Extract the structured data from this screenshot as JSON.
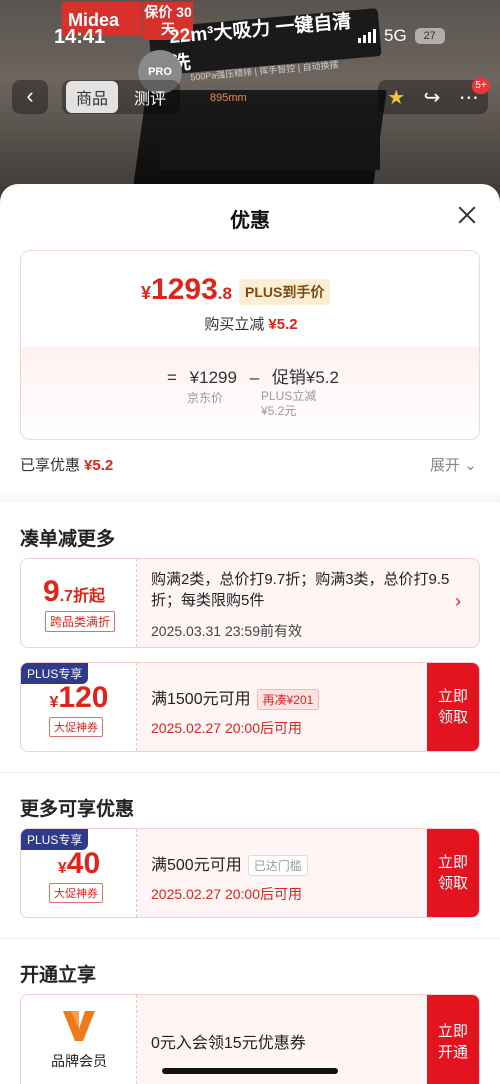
{
  "status_bar": {
    "time": "14:41",
    "network": "5G",
    "battery": "27"
  },
  "hero": {
    "brand": "Midea",
    "brand_tag": "保价 30天",
    "slogan": "22m³大吸力 一键自清洗",
    "slogan_sub": "500Pa强压精排 | 挥手智控 | 自动换摆",
    "pro_badge": "PRO",
    "dimension": "895mm"
  },
  "nav": {
    "back_icon": "chevron-left-icon",
    "tabs": [
      {
        "label": "商品",
        "active": true
      },
      {
        "label": "测评",
        "active": false
      }
    ],
    "actions": [
      "star-icon",
      "share-icon",
      "more-icon"
    ],
    "message_badge": "5+"
  },
  "sheet": {
    "title": "优惠",
    "price_card": {
      "currency": "¥",
      "price_int": "1293",
      "price_dec": ".8",
      "plus_tag": "PLUS到手价",
      "instant_off_label": "购买立减",
      "instant_off_value": "¥5.2",
      "formula": {
        "eq": "=",
        "jd_price": "¥1299",
        "minus": "–",
        "promo": "促销¥5.2"
      },
      "jd_label": "京东价",
      "promo_detail_1": "PLUS立减",
      "promo_detail_2": "¥5.2元"
    },
    "enjoyed_label": "已享优惠",
    "enjoyed_value": "¥5.2",
    "expand_label": "展开 ⌄",
    "sections": {
      "more_orders": "凑单减更多",
      "more_offers": "更多可享优惠",
      "open_enjoy": "开通立享"
    },
    "discount_offer": {
      "big": "9",
      "small": ".7折起",
      "tag": "跨品类满折",
      "desc": "购满2类，总价打9.7折；购满3类，总价打9.5折；每类限购5件",
      "valid": "2025.03.31 23:59前有效"
    },
    "coupon1": {
      "flag": "PLUS专享",
      "currency": "¥",
      "amount": "120",
      "kind": "大促神券",
      "condition": "满1500元可用",
      "tag": "再凑¥201",
      "date": "2025.02.27 20:00后可用",
      "button": "立即领取"
    },
    "coupon2": {
      "flag": "PLUS专享",
      "currency": "¥",
      "amount": "40",
      "kind": "大促神券",
      "condition": "满500元可用",
      "tag": "已达门槛",
      "date": "2025.02.27 20:00后可用",
      "button": "立即领取"
    },
    "membership": {
      "name": "品牌会员",
      "text": "0元入会领15元优惠券",
      "button": "立即开通"
    }
  },
  "colors": {
    "accent_red": "#e3131f",
    "price_red": "#e0241a",
    "plus_blue": "#2e3a8c"
  }
}
